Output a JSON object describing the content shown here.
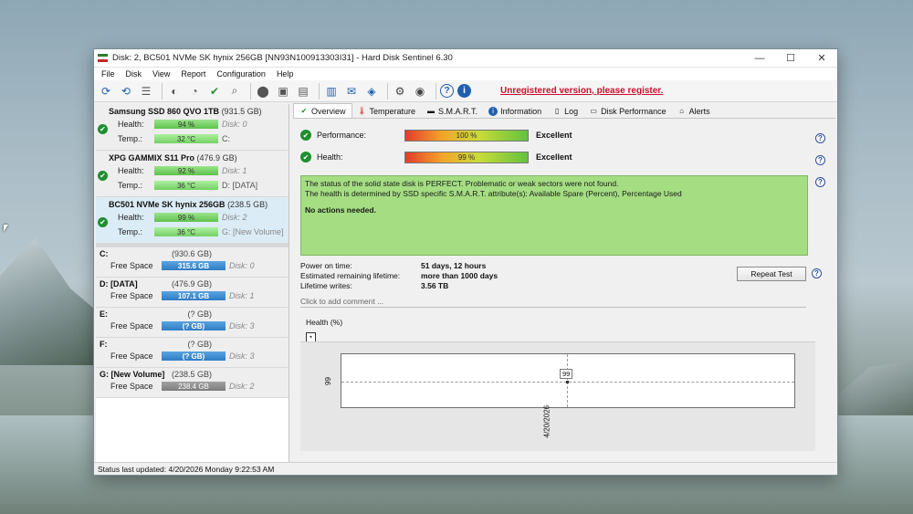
{
  "window": {
    "title": "Disk: 2, BC501 NVMe SK hynix 256GB [NN93N100913303I31]  -  Hard Disk Sentinel 6.30",
    "controls": {
      "minimize": "—",
      "maximize": "☐",
      "close": "✕"
    }
  },
  "menu": [
    "File",
    "Disk",
    "View",
    "Report",
    "Configuration",
    "Help"
  ],
  "toolbar": {
    "unregistered": "Unregistered version, please register."
  },
  "disks": [
    {
      "name": "Samsung SSD 860 QVO 1TB",
      "size": "(931.5 GB)",
      "health_label": "Health:",
      "health": "94 %",
      "temp_label": "Temp.:",
      "temp": "32 °C",
      "disk": "Disk: 0",
      "drive": "C:"
    },
    {
      "name": "XPG GAMMIX S11 Pro",
      "size": "(476.9 GB)",
      "health_label": "Health:",
      "health": "92 %",
      "temp_label": "Temp.:",
      "temp": "36 °C",
      "disk": "Disk: 1",
      "drive": "D: [DATA]"
    },
    {
      "name": "BC501 NVMe SK hynix 256GB",
      "size": "(238.5 GB)",
      "health_label": "Health:",
      "health": "99 %",
      "temp_label": "Temp.:",
      "temp": "36 °C",
      "disk": "Disk: 2",
      "drive": "G: [New Volume]"
    }
  ],
  "volumes": [
    {
      "name": "C:",
      "size": "(930.6 GB)",
      "free_label": "Free Space",
      "free": "315.6 GB",
      "disk": "Disk: 0"
    },
    {
      "name": "D: [DATA]",
      "size": "(476.9 GB)",
      "free_label": "Free Space",
      "free": "107.1 GB",
      "disk": "Disk: 1"
    },
    {
      "name": "E:",
      "size": "(? GB)",
      "free_label": "Free Space",
      "free": "(? GB)",
      "disk": "Disk: 3"
    },
    {
      "name": "F:",
      "size": "(? GB)",
      "free_label": "Free Space",
      "free": "(? GB)",
      "disk": "Disk: 3"
    },
    {
      "name": "G: [New Volume]",
      "size": "(238.5 GB)",
      "free_label": "Free Space",
      "free": "238.4 GB",
      "disk": "Disk: 2"
    }
  ],
  "tabs": [
    "Overview",
    "Temperature",
    "S.M.A.R.T.",
    "Information",
    "Log",
    "Disk Performance",
    "Alerts"
  ],
  "overview": {
    "performance_label": "Performance:",
    "performance_value": "100 %",
    "performance_status": "Excellent",
    "health_label": "Health:",
    "health_value": "99 %",
    "health_status": "Excellent",
    "status_line1": "The status of the solid state disk is PERFECT. Problematic or weak sectors were not found.",
    "status_line2": "The health is determined by SSD specific S.M.A.R.T. attribute(s):  Available Spare (Percent), Percentage Used",
    "status_actions": "No actions needed.",
    "power_on_label": "Power on time:",
    "power_on_value": "51 days, 12 hours",
    "remaining_label": "Estimated remaining lifetime:",
    "remaining_value": "more than 1000 days",
    "writes_label": "Lifetime writes:",
    "writes_value": "3.56 TB",
    "repeat_test": "Repeat Test",
    "comment_placeholder": "Click to add comment ..."
  },
  "graph": {
    "title": "Health (%)",
    "y_tick": "99",
    "point_label": "99",
    "x_tick": "4/20/2026"
  },
  "statusbar": {
    "text": "Status last updated: 4/20/2026 Monday 9:22:53 AM"
  },
  "colors": {
    "unregistered": "#c8102e",
    "status_green": "#a4dd82",
    "check_green": "#1e8f2f",
    "free_blue": "#2f7cc4"
  }
}
